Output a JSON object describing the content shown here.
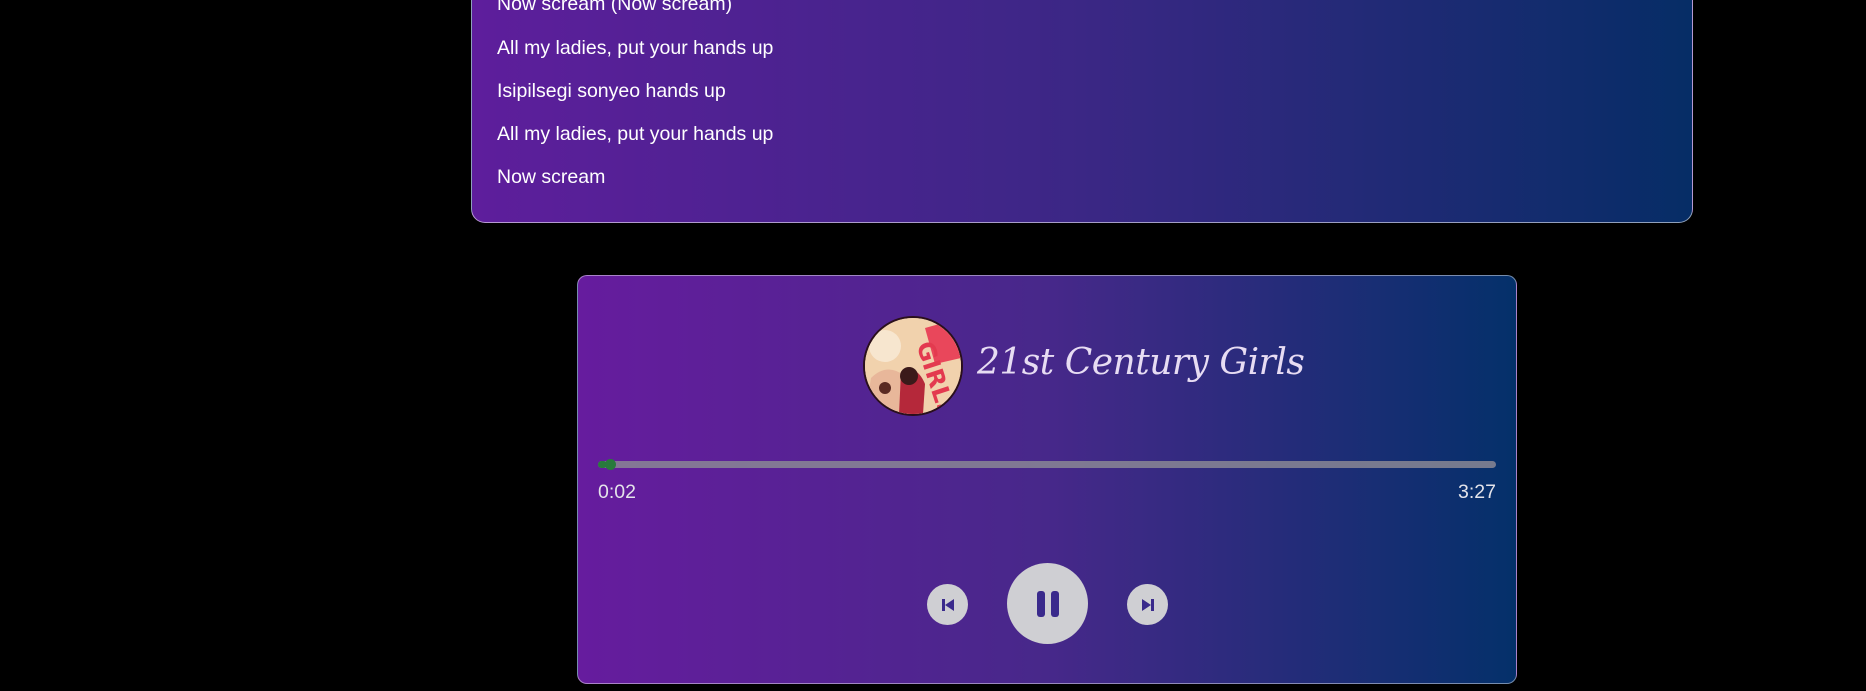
{
  "lyrics": {
    "lines": [
      "Now scream (Now scream)",
      "All my ladies, put your hands up",
      "Isipilsegi sonyeo hands up",
      "All my ladies, put your hands up",
      "Now scream"
    ]
  },
  "player": {
    "title": "21st Century Girls",
    "current_time": "0:02",
    "total_time": "3:27",
    "progress_fraction": 0.01,
    "state": "playing",
    "controls": {
      "previous_icon": "skip-previous-icon",
      "play_pause_icon": "pause-icon",
      "next_icon": "skip-next-icon"
    },
    "cover_art_text": "GIRLS"
  },
  "colors": {
    "background": "#000000",
    "gradient_start": "#661c9e",
    "gradient_end": "#04306a",
    "progress_fill": "#1e8b2c",
    "progress_track": "#8a8794",
    "button_fill": "#cfcfd3",
    "button_icon": "#3a2a8c"
  }
}
